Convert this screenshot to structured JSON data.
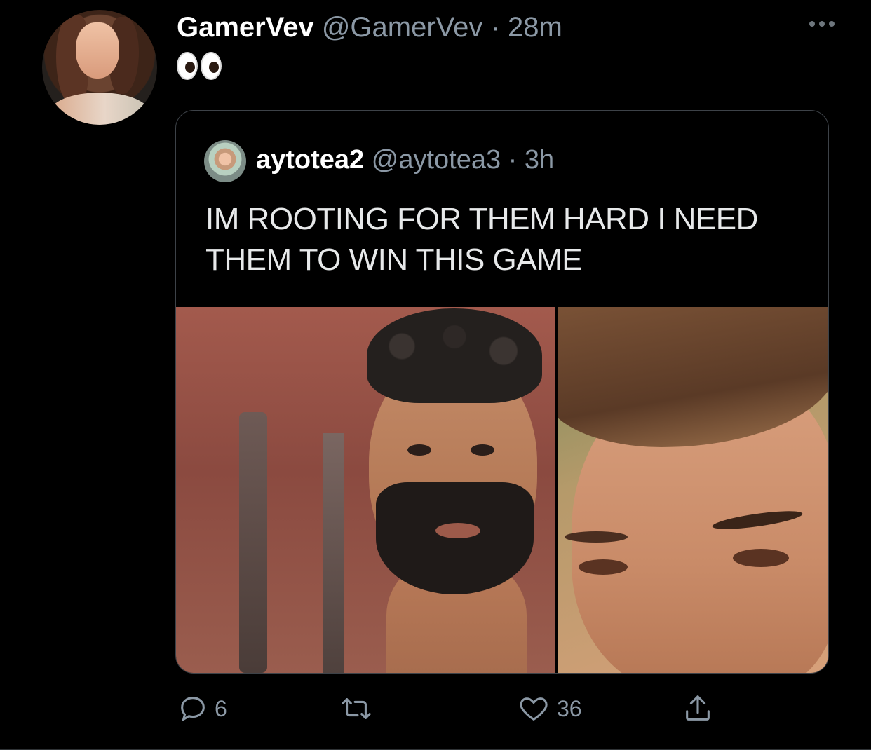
{
  "tweet": {
    "display_name": "GamerVev",
    "handle": "@GamerVev",
    "separator": "·",
    "time": "28m",
    "emoji_text": "👀"
  },
  "quoted_tweet": {
    "display_name": "aytotea2",
    "handle": "@aytotea3",
    "separator": "·",
    "time": "3h",
    "text": "IM ROOTING FOR THEM HARD I NEED THEM TO WIN THIS GAME"
  },
  "actions": {
    "reply_count": "6",
    "retweet_count": "",
    "like_count": "36"
  },
  "icons": {
    "more": "more-horizontal-icon",
    "reply": "reply-icon",
    "retweet": "retweet-icon",
    "like": "heart-icon",
    "share": "share-icon"
  },
  "colors": {
    "background": "#000000",
    "secondary_text": "#8b98a5",
    "border": "#3d4248"
  }
}
